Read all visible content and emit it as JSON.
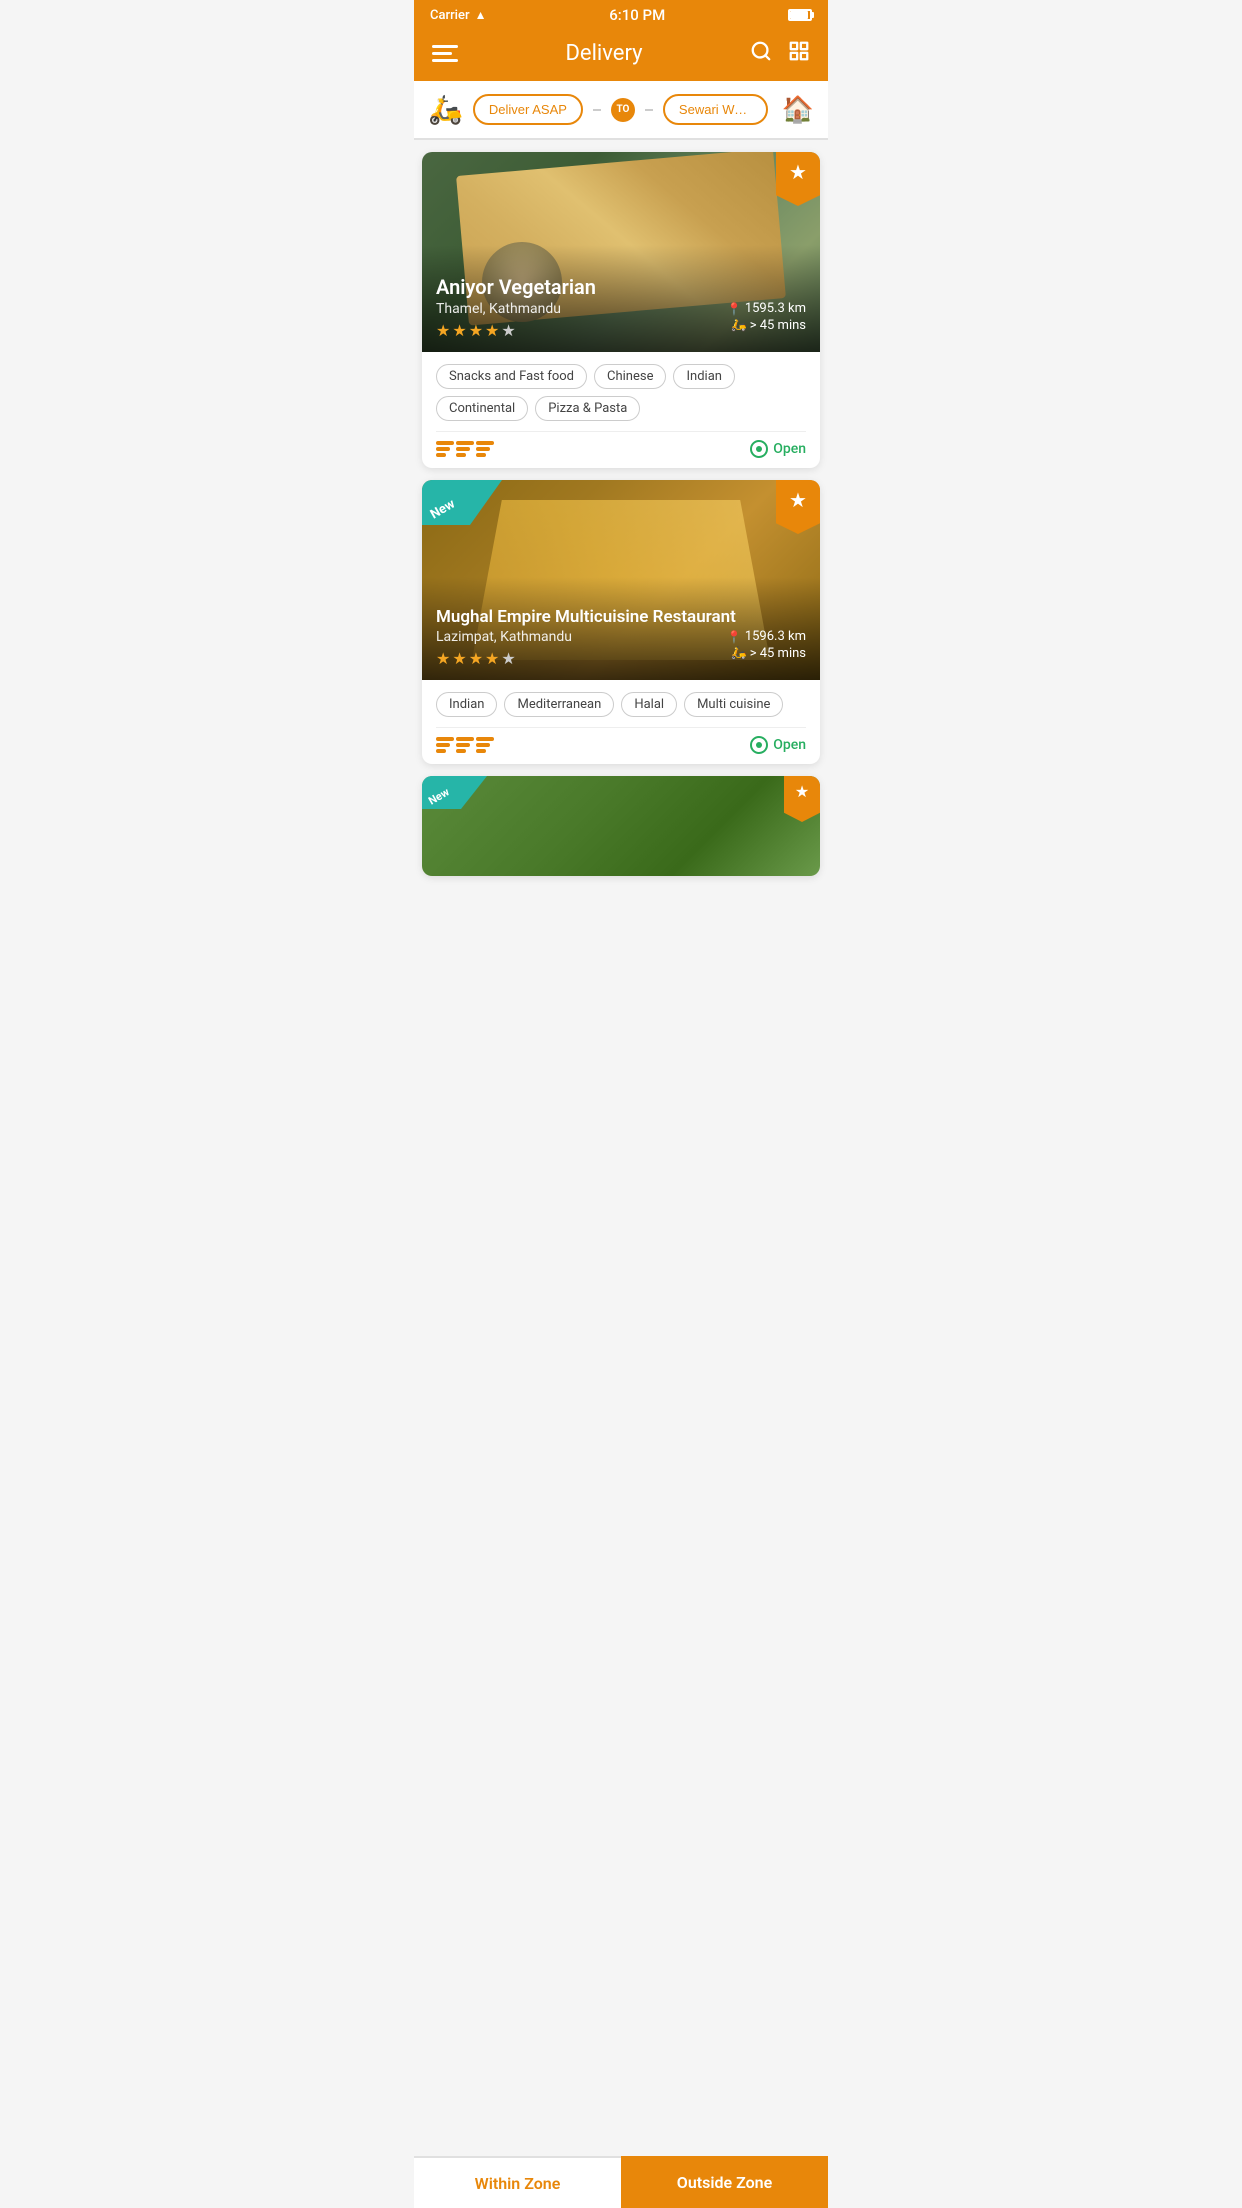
{
  "statusBar": {
    "carrier": "Carrier",
    "time": "6:10 PM",
    "wifi": "wifi"
  },
  "header": {
    "title": "Delivery",
    "searchLabel": "search",
    "filterLabel": "filter"
  },
  "deliveryBar": {
    "deliverASAP": "Deliver ASAP",
    "to": "TO",
    "address": "Sewari Wadala Roa...",
    "homeIcon": "🏠"
  },
  "restaurants": [
    {
      "name": "Aniyor Vegetarian",
      "location": "Thamel, Kathmandu",
      "distance": "1595.3 km",
      "time": "> 45 mins",
      "stars": 4,
      "totalStars": 5,
      "isFavorite": true,
      "isNew": false,
      "isOpen": true,
      "cuisines": [
        "Snacks and Fast food",
        "Chinese",
        "Indian",
        "Continental",
        "Pizza & Pasta"
      ],
      "openLabel": "Open"
    },
    {
      "name": "Mughal Empire Multicuisine Restaurant",
      "location": "Lazimpat, Kathmandu",
      "distance": "1596.3 km",
      "time": "> 45 mins",
      "stars": 4,
      "totalStars": 5,
      "isFavorite": true,
      "isNew": true,
      "isOpen": true,
      "cuisines": [
        "Indian",
        "Mediterranean",
        "Halal",
        "Multi cuisine"
      ],
      "openLabel": "Open",
      "newLabel": "New"
    }
  ],
  "zoneBar": {
    "withinZone": "Within Zone",
    "outsideZone": "Outside Zone"
  }
}
